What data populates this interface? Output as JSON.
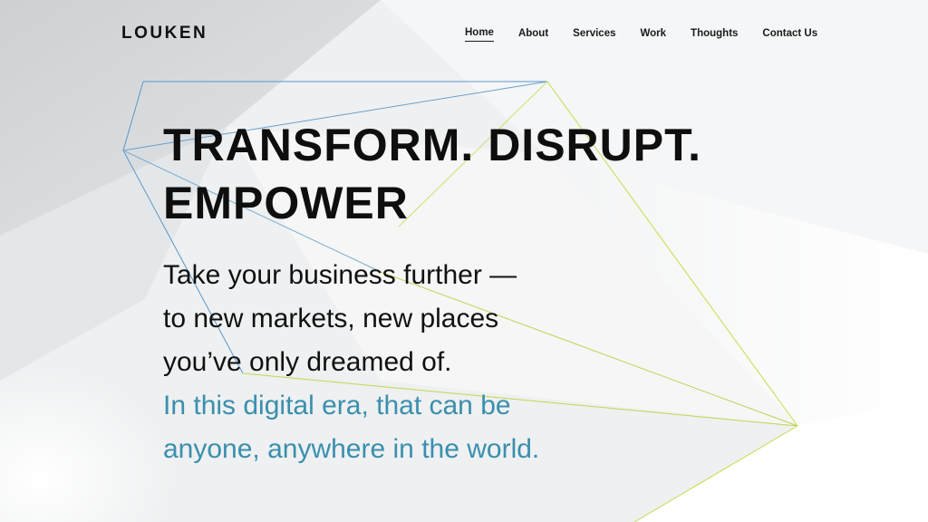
{
  "brand": {
    "logo_text": "LOUKEN"
  },
  "nav": {
    "items": [
      {
        "label": "Home",
        "active": true
      },
      {
        "label": "About",
        "active": false
      },
      {
        "label": "Services",
        "active": false
      },
      {
        "label": "Work",
        "active": false
      },
      {
        "label": "Thoughts",
        "active": false
      },
      {
        "label": "Contact Us",
        "active": false
      }
    ]
  },
  "hero": {
    "headline_line1": "TRANSFORM. DISRUPT.",
    "headline_line2": "EMPOWER",
    "tagline_line1": "Take your business further —",
    "tagline_line2": "to new markets, new places",
    "tagline_line3": "you’ve only dreamed of.",
    "tagline_line4": "In this digital era, that can be",
    "tagline_line5": "anyone, anywhere in the world."
  },
  "colors": {
    "text": "#111111",
    "accent_text": "#3a8fad",
    "line_blue": "#5a96c8",
    "line_green": "#c7dc48",
    "background": "#f1f2f3"
  }
}
